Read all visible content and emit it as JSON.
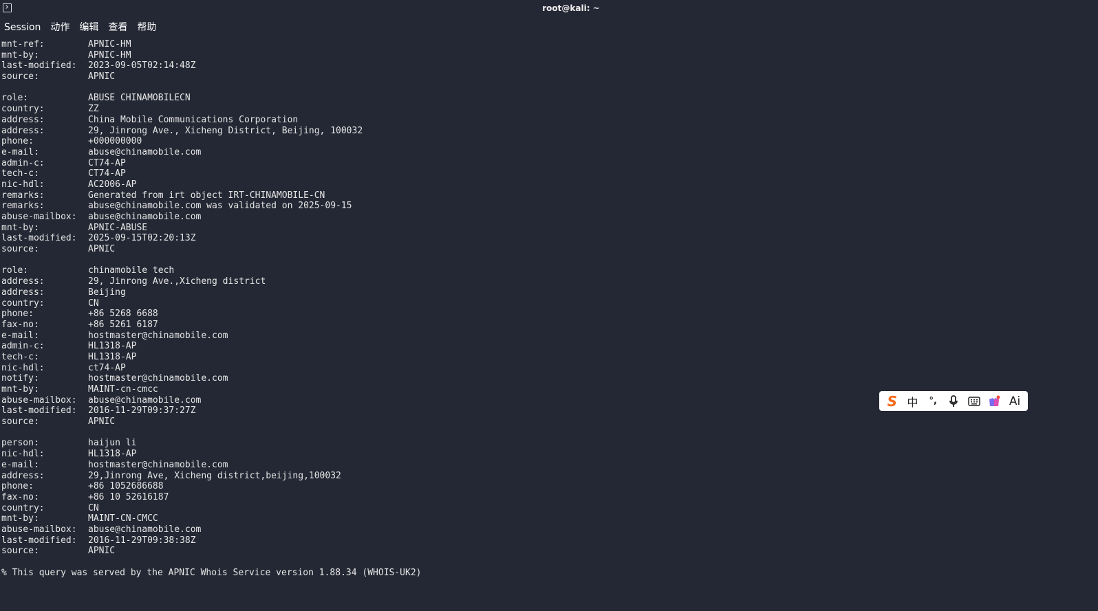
{
  "window": {
    "title": "root@kali: ~"
  },
  "menu": [
    "Session",
    "动作",
    "编辑",
    "查看",
    "帮助"
  ],
  "blocks": [
    [
      {
        "k": "mnt-ref:",
        "v": "APNIC-HM"
      },
      {
        "k": "mnt-by:",
        "v": "APNIC-HM"
      },
      {
        "k": "last-modified:",
        "v": "2023-09-05T02:14:48Z"
      },
      {
        "k": "source:",
        "v": "APNIC"
      }
    ],
    [
      {
        "k": "role:",
        "v": "ABUSE CHINAMOBILECN"
      },
      {
        "k": "country:",
        "v": "ZZ"
      },
      {
        "k": "address:",
        "v": "China Mobile Communications Corporation"
      },
      {
        "k": "address:",
        "v": "29, Jinrong Ave., Xicheng District, Beijing, 100032"
      },
      {
        "k": "phone:",
        "v": "+000000000"
      },
      {
        "k": "e-mail:",
        "v": "abuse@chinamobile.com"
      },
      {
        "k": "admin-c:",
        "v": "CT74-AP"
      },
      {
        "k": "tech-c:",
        "v": "CT74-AP"
      },
      {
        "k": "nic-hdl:",
        "v": "AC2006-AP"
      },
      {
        "k": "remarks:",
        "v": "Generated from irt object IRT-CHINAMOBILE-CN"
      },
      {
        "k": "remarks:",
        "v": "abuse@chinamobile.com was validated on 2025-09-15"
      },
      {
        "k": "abuse-mailbox:",
        "v": "abuse@chinamobile.com"
      },
      {
        "k": "mnt-by:",
        "v": "APNIC-ABUSE"
      },
      {
        "k": "last-modified:",
        "v": "2025-09-15T02:20:13Z"
      },
      {
        "k": "source:",
        "v": "APNIC"
      }
    ],
    [
      {
        "k": "role:",
        "v": "chinamobile tech"
      },
      {
        "k": "address:",
        "v": "29, Jinrong Ave.,Xicheng district"
      },
      {
        "k": "address:",
        "v": "Beijing"
      },
      {
        "k": "country:",
        "v": "CN"
      },
      {
        "k": "phone:",
        "v": "+86 5268 6688"
      },
      {
        "k": "fax-no:",
        "v": "+86 5261 6187"
      },
      {
        "k": "e-mail:",
        "v": "hostmaster@chinamobile.com"
      },
      {
        "k": "admin-c:",
        "v": "HL1318-AP"
      },
      {
        "k": "tech-c:",
        "v": "HL1318-AP"
      },
      {
        "k": "nic-hdl:",
        "v": "ct74-AP"
      },
      {
        "k": "notify:",
        "v": "hostmaster@chinamobile.com"
      },
      {
        "k": "mnt-by:",
        "v": "MAINT-cn-cmcc"
      },
      {
        "k": "abuse-mailbox:",
        "v": "abuse@chinamobile.com"
      },
      {
        "k": "last-modified:",
        "v": "2016-11-29T09:37:27Z"
      },
      {
        "k": "source:",
        "v": "APNIC"
      }
    ],
    [
      {
        "k": "person:",
        "v": "haijun li"
      },
      {
        "k": "nic-hdl:",
        "v": "HL1318-AP"
      },
      {
        "k": "e-mail:",
        "v": "hostmaster@chinamobile.com"
      },
      {
        "k": "address:",
        "v": "29,Jinrong Ave, Xicheng district,beijing,100032"
      },
      {
        "k": "phone:",
        "v": "+86 1052686688"
      },
      {
        "k": "fax-no:",
        "v": "+86 10 52616187"
      },
      {
        "k": "country:",
        "v": "CN"
      },
      {
        "k": "mnt-by:",
        "v": "MAINT-CN-CMCC"
      },
      {
        "k": "abuse-mailbox:",
        "v": "abuse@chinamobile.com"
      },
      {
        "k": "last-modified:",
        "v": "2016-11-29T09:38:38Z"
      },
      {
        "k": "source:",
        "v": "APNIC"
      }
    ]
  ],
  "footer": "% This query was served by the APNIC Whois Service version 1.88.34 (WHOIS-UK2)",
  "ime_toolbar": {
    "logo": "S",
    "lang": "中",
    "punct": "°,",
    "ai": "Ai",
    "icons": [
      "sogou-logo-icon",
      "chinese-mode-icon",
      "punctuation-icon",
      "microphone-icon",
      "keyboard-icon",
      "skin-icon",
      "ai-icon"
    ]
  },
  "colors": {
    "background": "#242834",
    "text": "#e6e6e6",
    "ime_accent": "#f46a1b"
  }
}
